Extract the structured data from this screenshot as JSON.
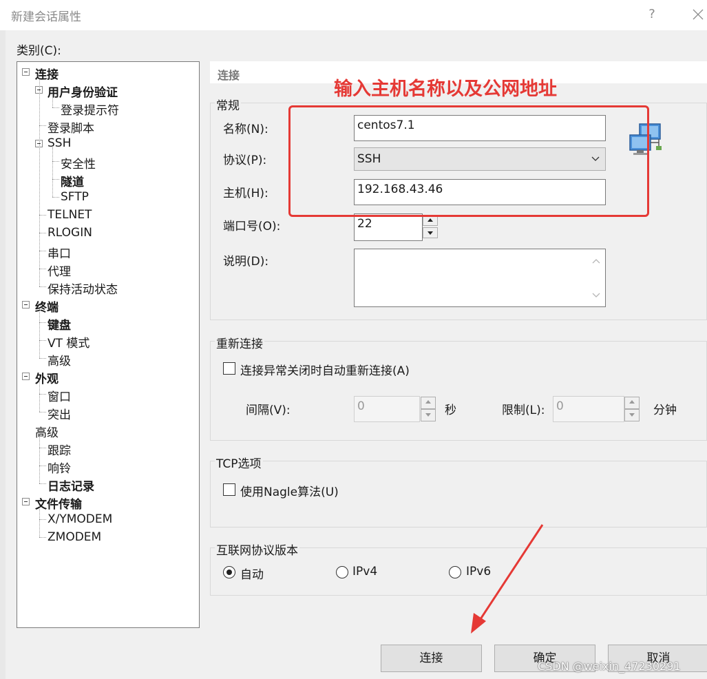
{
  "window": {
    "title": "新建会话属性",
    "help_label": "?"
  },
  "category": {
    "label": "类别(C):",
    "tree": [
      {
        "label": "连接",
        "bold": true,
        "level": 0
      },
      {
        "label": "用户身份验证",
        "bold": true,
        "level": 1
      },
      {
        "label": "登录提示符",
        "bold": false,
        "level": 2
      },
      {
        "label": "登录脚本",
        "bold": false,
        "level": 1
      },
      {
        "label": "SSH",
        "bold": false,
        "level": 1
      },
      {
        "label": "安全性",
        "bold": false,
        "level": 2
      },
      {
        "label": "隧道",
        "bold": true,
        "level": 2
      },
      {
        "label": "SFTP",
        "bold": false,
        "level": 2
      },
      {
        "label": "TELNET",
        "bold": false,
        "level": 1
      },
      {
        "label": "RLOGIN",
        "bold": false,
        "level": 1
      },
      {
        "label": "串口",
        "bold": false,
        "level": 1
      },
      {
        "label": "代理",
        "bold": false,
        "level": 1
      },
      {
        "label": "保持活动状态",
        "bold": false,
        "level": 1
      },
      {
        "label": "终端",
        "bold": true,
        "level": 0
      },
      {
        "label": "键盘",
        "bold": true,
        "level": 1
      },
      {
        "label": "VT 模式",
        "bold": false,
        "level": 1
      },
      {
        "label": "高级",
        "bold": false,
        "level": 1
      },
      {
        "label": "外观",
        "bold": true,
        "level": 0
      },
      {
        "label": "窗口",
        "bold": false,
        "level": 1
      },
      {
        "label": "突出",
        "bold": false,
        "level": 1
      },
      {
        "label": "高级",
        "bold": false,
        "level": 0
      },
      {
        "label": "跟踪",
        "bold": false,
        "level": 1
      },
      {
        "label": "响铃",
        "bold": false,
        "level": 1
      },
      {
        "label": "日志记录",
        "bold": true,
        "level": 1
      },
      {
        "label": "文件传输",
        "bold": true,
        "level": 0
      },
      {
        "label": "X/YMODEM",
        "bold": false,
        "level": 1
      },
      {
        "label": "ZMODEM",
        "bold": false,
        "level": 1
      }
    ]
  },
  "connection": {
    "section_title": "连接",
    "general": {
      "group_label": "常规",
      "name_label": "名称(N):",
      "name_value": "centos7.1",
      "protocol_label": "协议(P):",
      "protocol_value": "SSH",
      "host_label": "主机(H):",
      "host_value": "192.168.43.46",
      "port_label": "端口号(O):",
      "port_value": "22",
      "description_label": "说明(D):",
      "description_value": ""
    },
    "reconnect": {
      "group_label": "重新连接",
      "checkbox_label": "连接异常关闭时自动重新连接(A)",
      "checked": false,
      "interval_label": "间隔(V):",
      "interval_value": "0",
      "interval_unit": "秒",
      "limit_label": "限制(L):",
      "limit_value": "0",
      "limit_unit": "分钟"
    },
    "tcp": {
      "group_label": "TCP选项",
      "nagle_label": "使用Nagle算法(U)",
      "checked": false
    },
    "ip_version": {
      "group_label": "互联网协议版本",
      "options": [
        "自动",
        "IPv4",
        "IPv6"
      ],
      "selected": "自动"
    }
  },
  "buttons": {
    "connect": "连接",
    "ok": "确定",
    "cancel": "取消"
  },
  "annotation": {
    "text": "输入主机名称以及公网地址",
    "color": "#e53935"
  },
  "watermark": "CSDN @weixin_47230291"
}
